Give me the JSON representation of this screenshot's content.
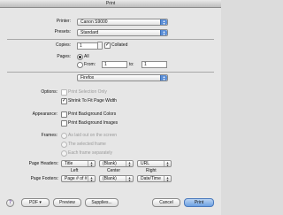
{
  "window": {
    "title": "Print"
  },
  "printer": {
    "label": "Printer:",
    "value": "Canon S9000"
  },
  "presets": {
    "label": "Presets:",
    "value": "Standard"
  },
  "copies": {
    "label": "Copies:",
    "value": "1",
    "collated_label": "Collated",
    "collated": true
  },
  "pages": {
    "label": "Pages:",
    "all_label": "All",
    "from_label": "From:",
    "from_value": "1",
    "to_label": "to:",
    "to_value": "1",
    "selected": "All"
  },
  "panel": {
    "value": "Firefox"
  },
  "options": {
    "label": "Options:",
    "print_selection_only": {
      "label": "Print Selection Only",
      "checked": false,
      "enabled": false
    },
    "shrink_to_fit": {
      "label": "Shrink To Fit Page Width",
      "checked": true
    }
  },
  "appearance": {
    "label": "Appearance:",
    "bg_colors": {
      "label": "Print Background Colors",
      "checked": false
    },
    "bg_images": {
      "label": "Print Background Images",
      "checked": false
    }
  },
  "frames": {
    "label": "Frames:",
    "items": [
      "As laid out on the screen",
      "The selected frame",
      "Each frame separately"
    ]
  },
  "headers": {
    "label": "Page Headers:",
    "left": "Title",
    "center": "(Blank)",
    "right": "URL"
  },
  "columns": {
    "left": "Left",
    "center": "Center",
    "right": "Right"
  },
  "footers": {
    "label": "Page Footers:",
    "left": "Page # of #",
    "center": "(Blank)",
    "right": "Date/Time"
  },
  "bottom": {
    "help": "?",
    "pdf": "PDF ▾",
    "preview": "Preview",
    "supplies": "Supplies...",
    "cancel": "Cancel",
    "print": "Print"
  }
}
